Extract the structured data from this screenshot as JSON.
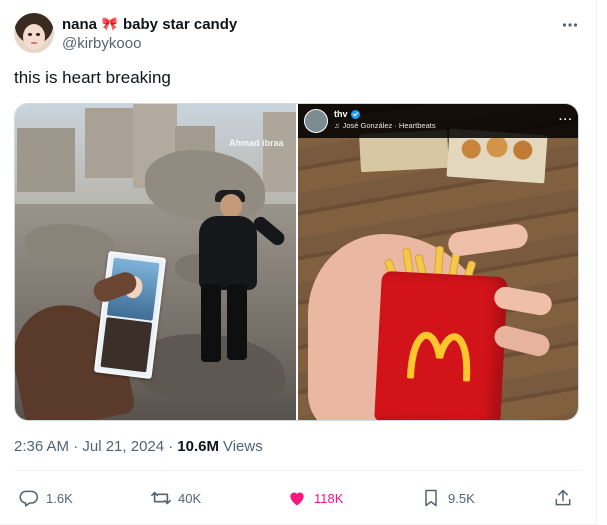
{
  "author": {
    "display_name": "nana",
    "name_emoji": "🎀",
    "name_suffix": "baby star candy",
    "handle": "@kirbykooo"
  },
  "tweet": {
    "text": "this is heart breaking"
  },
  "media": {
    "left": {
      "watermark": "Ahmad ibraa"
    },
    "right": {
      "account_name": "thv",
      "song": "José González · Heartbeats"
    }
  },
  "meta": {
    "timestamp": "2:36 AM · Jul 21, 2024 ·",
    "views_count": "10.6M",
    "views_label": "Views"
  },
  "actions": {
    "replies": "1.6K",
    "reposts": "40K",
    "likes": "118K",
    "bookmarks": "9.5K"
  },
  "colors": {
    "like": "#f91880",
    "muted": "#536471",
    "text": "#0f1419"
  }
}
